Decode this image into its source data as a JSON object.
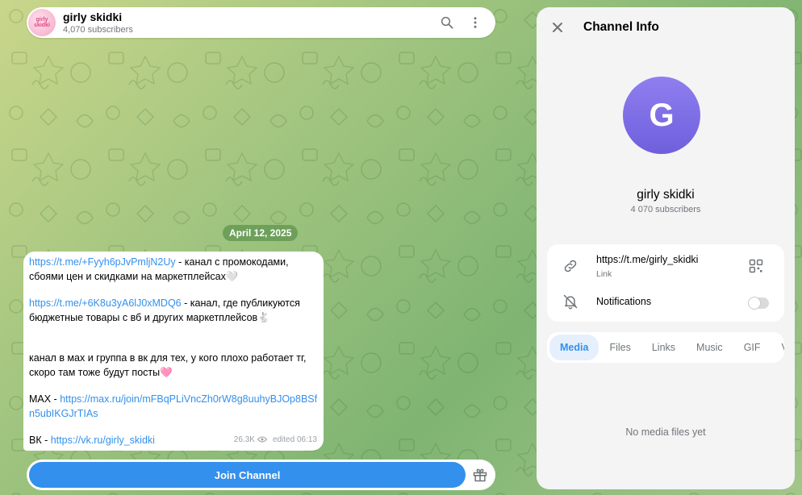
{
  "header": {
    "title": "girly skidki",
    "subscribers": "4,070 subscribers",
    "avatar_text": "girly skidki"
  },
  "date_pill": "April 12, 2025",
  "message": {
    "link1": "https://t.me/+Fyyh6pJvPmljN2Uy",
    "text1": " - канал с промокодами, сбоями цен и скидками на маркетплейсах🤍",
    "link2": "https://t.me/+6K8u3yA6lJ0xMDQ6",
    "text2": " - канал, где публикуются бюджетные товары с вб и других маркетплейсов🐇",
    "text3": "канал в мах и группа в вк для тех, у кого плохо работает тг, скоро там тоже будут посты🩷",
    "max_label": "MAX - ",
    "max_link": "https://max.ru/join/mFBqPLiVncZh0rW8g8uuhyBJOp8BSfn5ubIKGJrTIAs",
    "vk_label": "ВК - ",
    "vk_link": "https://vk.ru/girly_skidki",
    "views": "26.3K",
    "edited": "edited 06:13"
  },
  "join_bar": {
    "join_label": "Join Channel"
  },
  "panel": {
    "title": "Channel Info",
    "avatar_letter": "G",
    "channel_name": "girly skidki",
    "subscribers": "4 070 subscribers",
    "link_value": "https://t.me/girly_skidki",
    "link_label": "Link",
    "notifications_label": "Notifications",
    "notifications_on": false,
    "tabs": [
      "Media",
      "Files",
      "Links",
      "Music",
      "GIF",
      "Voice"
    ],
    "active_tab": "Media",
    "empty_text": "No media files yet"
  },
  "colors": {
    "accent": "#3390ec",
    "avatar_purple": "#7b6ce6"
  }
}
